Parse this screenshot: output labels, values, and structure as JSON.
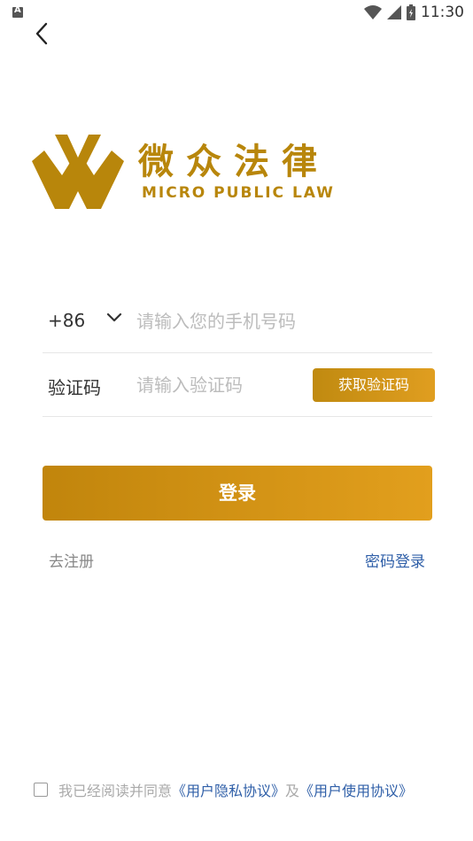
{
  "status_bar": {
    "time": "11:30",
    "icons": [
      "app-notification-icon",
      "wifi-icon",
      "signal-icon",
      "battery-icon"
    ]
  },
  "header": {
    "back_icon": "back-arrow-icon"
  },
  "logo": {
    "title": "微众法律",
    "subtitle": "MICRO PUBLIC LAW",
    "color": "#b8860b"
  },
  "form": {
    "country_code": "+86",
    "phone_placeholder": "请输入您的手机号码",
    "code_label": "验证码",
    "code_placeholder": "请输入验证码",
    "get_code_label": "获取验证码"
  },
  "login_button": {
    "label": "登录"
  },
  "links": {
    "register": "去注册",
    "password_login": "密码登录"
  },
  "agreement": {
    "prefix": "我已经阅读并同意",
    "privacy": "《用户隐私协议》",
    "and": "及",
    "usage": "《用户使用协议》"
  },
  "colors": {
    "accent": "#d4971a",
    "link": "#2f5fa8"
  }
}
